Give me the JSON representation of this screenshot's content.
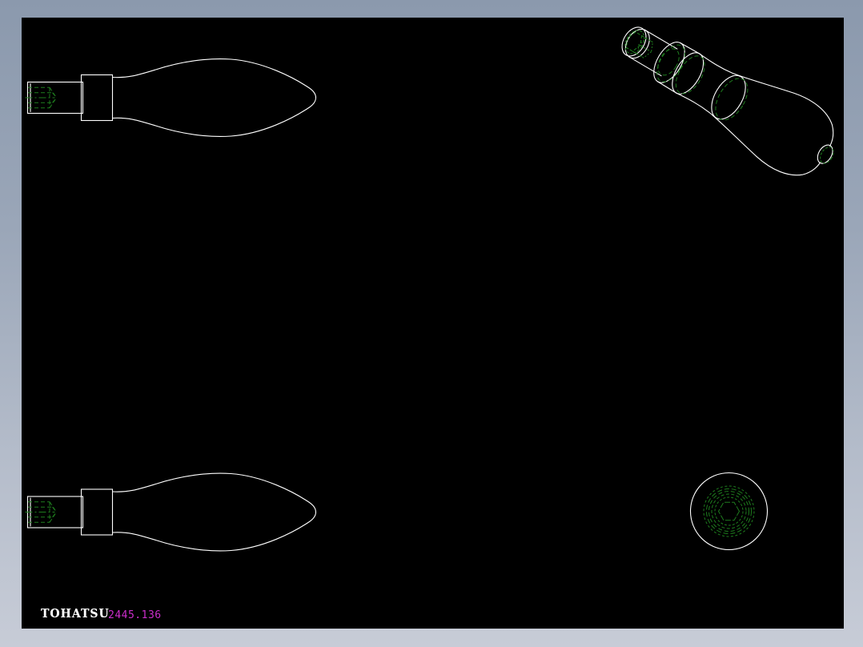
{
  "window": {
    "description": "CAD viewer canvas showing an engineering drawing of a tool handle with hex socket",
    "background": "#000000"
  },
  "footer": {
    "brand": "TOHATSU",
    "part_number": "2445.136"
  },
  "colors": {
    "canvas_background": "#000000",
    "frame_gradient_top": "#8b99ad",
    "frame_gradient_bottom": "#c7ccd7",
    "visible_edge": "#ffffff",
    "hidden_edge": "#1e7d1e",
    "part_number_text": "#cc2ecc",
    "brand_text": "#ffffff"
  },
  "views": [
    {
      "id": "side-view-top",
      "label": "side view of handle (top left)"
    },
    {
      "id": "isometric-view",
      "label": "isometric view of handle (top right)"
    },
    {
      "id": "side-view-bottom",
      "label": "side view of handle (bottom left)"
    },
    {
      "id": "end-view",
      "label": "end view with hex socket (bottom right)"
    }
  ]
}
